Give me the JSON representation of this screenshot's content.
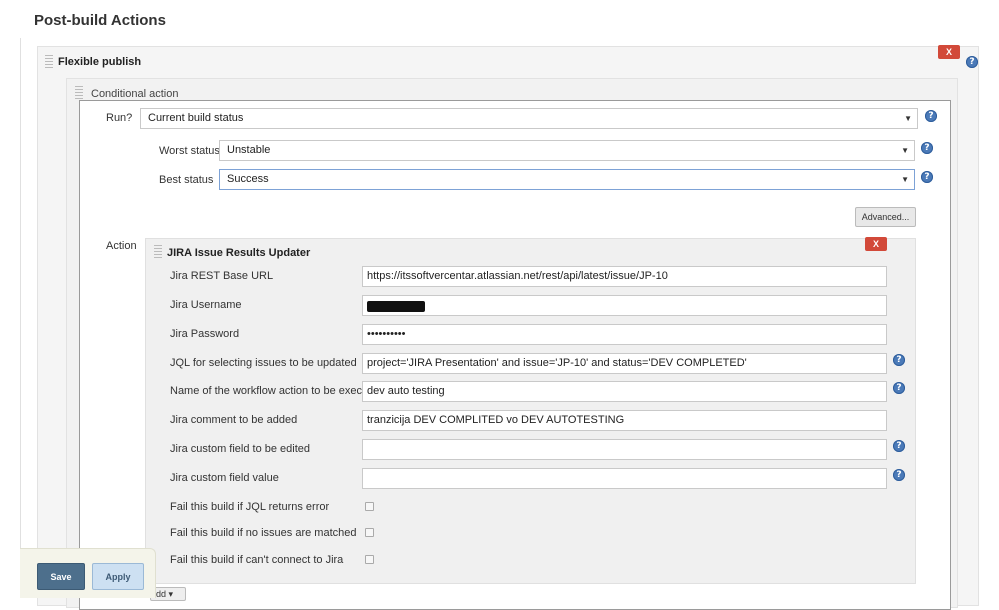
{
  "section": {
    "title": "Post-build Actions"
  },
  "flexible_publish": {
    "title": "Flexible publish",
    "delete_label": "X",
    "help_icon": "question-circle-icon"
  },
  "conditional_action": {
    "title": "Conditional action",
    "run_label": "Run?",
    "run_value": "Current build status",
    "worst_status_label": "Worst status",
    "worst_status_value": "Unstable",
    "best_status_label": "Best status",
    "best_status_value": "Success",
    "advanced_label": "Advanced...",
    "action_label": "Action"
  },
  "jira_updater": {
    "title": "JIRA Issue Results Updater",
    "delete_label": "X",
    "fields": [
      {
        "label": "Jira REST Base URL",
        "value": "https://itssoftvercentar.atlassian.net/rest/api/latest/issue/JP-10"
      },
      {
        "label": "Jira Username",
        "value": ""
      },
      {
        "label": "Jira Password",
        "value": "••••••••••"
      },
      {
        "label": "JQL for selecting issues to be updated",
        "value": "project='JIRA Presentation' and issue='JP-10' and status='DEV COMPLETED'"
      },
      {
        "label": "Name of the workflow action to be executed",
        "value": "dev auto testing"
      },
      {
        "label": "Jira comment to be added",
        "value": "tranzicija DEV COMPLITED vo DEV AUTOTESTING"
      },
      {
        "label": "Jira custom field to be edited",
        "value": ""
      },
      {
        "label": "Jira custom field value",
        "value": ""
      }
    ],
    "checkboxes": [
      {
        "label": "Fail this build if JQL returns error",
        "checked": false
      },
      {
        "label": "Fail this build if no issues are matched",
        "checked": false
      },
      {
        "label": "Fail this build if can't connect to Jira",
        "checked": false
      }
    ]
  },
  "footer": {
    "save_label": "Save",
    "apply_label": "Apply",
    "add_label": "dd"
  },
  "colors": {
    "delete_button": "#d24939",
    "save_button": "#4d6f8c",
    "apply_button": "#cde0f2",
    "help_icon": "#4b7ab8"
  }
}
